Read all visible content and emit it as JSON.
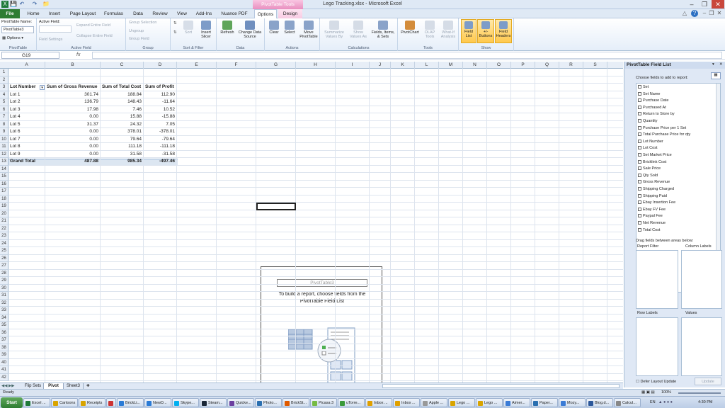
{
  "window": {
    "title": "Lego Tracking.xlsx - Microsoft Excel",
    "context_tools": "PivotTable Tools"
  },
  "tabs": {
    "file": "File",
    "home": "Home",
    "insert": "Insert",
    "page_layout": "Page Layout",
    "formulas": "Formulas",
    "data": "Data",
    "review": "Review",
    "view": "View",
    "addins": "Add-Ins",
    "nuance": "Nuance PDF",
    "options": "Options",
    "design": "Design"
  },
  "ribbon": {
    "pt_name_label": "PivotTable Name:",
    "pt_name_value": "PivotTable3",
    "options_label": "Options",
    "group_pivottable": "PivotTable",
    "active_field_label": "Active Field:",
    "field_settings": "Field Settings",
    "expand": "Expand Entire Field",
    "collapse": "Collapse Entire Field",
    "group_active_field": "Active Field",
    "group_selection": "Group Selection",
    "ungroup": "Ungroup",
    "group_field": "Group Field",
    "group_group": "Group",
    "sort": "Sort",
    "insert_slicer_1": "Insert",
    "insert_slicer_2": "Slicer",
    "group_sort": "Sort & Filter",
    "refresh": "Refresh",
    "change_source_1": "Change Data",
    "change_source_2": "Source",
    "group_data": "Data",
    "clear": "Clear",
    "select": "Select",
    "move_1": "Move",
    "move_2": "PivotTable",
    "group_actions": "Actions",
    "summarize_1": "Summarize",
    "summarize_2": "Values By",
    "show_values_1": "Show",
    "show_values_2": "Values As",
    "fields_items_1": "Fields, Items,",
    "fields_items_2": "& Sets",
    "group_calc": "Calculations",
    "pivotchart": "PivotChart",
    "olap_1": "OLAP",
    "olap_2": "Tools",
    "whatif_1": "What-If",
    "whatif_2": "Analysis",
    "group_tools": "Tools",
    "field_list_1": "Field",
    "field_list_2": "List",
    "buttons_1": "+/-",
    "buttons_2": "Buttons",
    "headers_1": "Field",
    "headers_2": "Headers",
    "group_show": "Show"
  },
  "formula_bar": {
    "name_box": "G19",
    "fx": "fx",
    "content": ""
  },
  "columns": [
    "A",
    "B",
    "C",
    "D",
    "E",
    "F",
    "G",
    "H",
    "I",
    "J",
    "K",
    "L",
    "M",
    "N",
    "O",
    "P",
    "Q",
    "R",
    "S"
  ],
  "rows": [
    "1",
    "2",
    "3",
    "4",
    "5",
    "6",
    "7",
    "8",
    "9",
    "10",
    "11",
    "12",
    "13",
    "14",
    "15",
    "16",
    "17",
    "18",
    "19",
    "20",
    "21",
    "22",
    "23",
    "24",
    "25",
    "26",
    "27",
    "28",
    "29",
    "30",
    "31",
    "32",
    "33",
    "34",
    "35",
    "36",
    "37",
    "38",
    "39",
    "40",
    "41",
    "42"
  ],
  "pivot": {
    "headers": [
      "Lot Number",
      "Sum of Gross Revenue",
      "Sum of Total Cost",
      "Sum of Profit"
    ],
    "rows": [
      [
        "Lot 1",
        "301.74",
        "188.84",
        "112.90"
      ],
      [
        "Lot 2",
        "136.79",
        "148.43",
        "-11.64"
      ],
      [
        "Lot 3",
        "17.98",
        "7.46",
        "10.52"
      ],
      [
        "Lot 4",
        "0.00",
        "15.88",
        "-15.88"
      ],
      [
        "Lot 5",
        "31.37",
        "24.32",
        "7.05"
      ],
      [
        "Lot 6",
        "0.00",
        "378.01",
        "-378.01"
      ],
      [
        "Lot 7",
        "0.00",
        "79.64",
        "-79.64"
      ],
      [
        "Lot 8",
        "0.00",
        "111.18",
        "-111.18"
      ],
      [
        "Lot 9",
        "0.00",
        "31.58",
        "-31.58"
      ]
    ],
    "total": [
      "Grand Total",
      "487.88",
      "985.34",
      "-497.46"
    ]
  },
  "placeholder": {
    "name": "PivotTable3",
    "message": "To build a report, choose fields from the PivotTable Field List"
  },
  "field_list": {
    "title": "PivotTable Field List",
    "choose": "Choose fields to add to report:",
    "fields": [
      "Set",
      "Set Name",
      "Purchase Date",
      "Purchased At",
      "Return to Store by",
      "Quantity",
      "Purchase Price per 1 Set",
      "Total Purchase Price for qty",
      "Lot Number",
      "Lot Cost",
      "Set Market Price",
      "Bricklink Cost",
      "Sale Price",
      "Qty Sold",
      "Gross Revenue",
      "Shipping Charged",
      "Shipping Paid",
      "Ebay Insertion Fee",
      "Ebay FV Fee",
      "Paypal Fee",
      "Net Revenue",
      "Total Cost"
    ],
    "drag": "Drag fields between areas below:",
    "report_filter": "Report Filter",
    "column_labels": "Column Labels",
    "row_labels": "Row Labels",
    "values": "Values",
    "defer": "Defer Layout Update",
    "update": "Update"
  },
  "sheets": [
    "Flip Sets",
    "Pivot",
    "Sheet3"
  ],
  "status": {
    "ready": "Ready",
    "zoom": "100%"
  },
  "taskbar": {
    "start": "Start",
    "items": [
      "Excel ...",
      "Cartoons",
      "Receipts",
      "",
      "BrickLi...",
      "NewD...",
      "Skype...",
      "Steam...",
      "Quicke...",
      "Photo...",
      "BrickSt...",
      "Picasa 3",
      "uTorre...",
      "Inbox ...",
      "Inbox ...",
      "Apple ...",
      "Lego ...",
      "Lego ...",
      "Aimer...",
      "Paper...",
      "Mozy...",
      "Blog.d...",
      "Calcul..."
    ],
    "lang": "EN",
    "time": "4:30 PM"
  }
}
